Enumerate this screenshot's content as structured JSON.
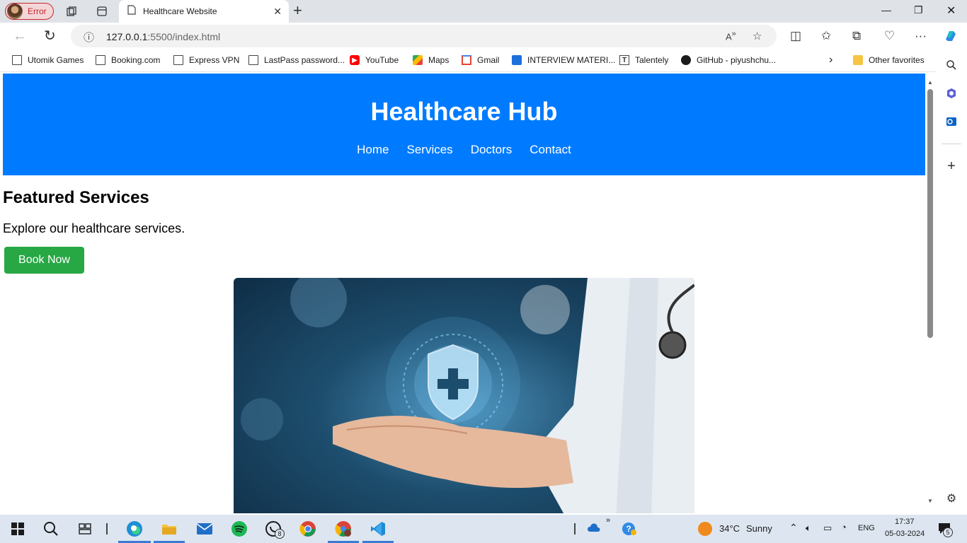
{
  "browser": {
    "profile_label": "Error",
    "tab_title": "Healthcare Website",
    "url_host": "127.0.0.1",
    "url_path": ":5500/index.html",
    "favorites": [
      {
        "label": "Utomik Games",
        "icon": "page-icon"
      },
      {
        "label": "Booking.com",
        "icon": "page-icon"
      },
      {
        "label": "Express VPN",
        "icon": "page-icon"
      },
      {
        "label": "LastPass password...",
        "icon": "page-icon"
      },
      {
        "label": "YouTube",
        "icon": "youtube-icon"
      },
      {
        "label": "Maps",
        "icon": "maps-icon"
      },
      {
        "label": "Gmail",
        "icon": "gmail-icon"
      },
      {
        "label": "INTERVIEW MATERI...",
        "icon": "interview-icon"
      },
      {
        "label": "Talentely",
        "icon": "talentely-icon"
      },
      {
        "label": "GitHub - piyushchu...",
        "icon": "github-icon"
      }
    ],
    "other_favorites": "Other favorites"
  },
  "site": {
    "title": "Healthcare Hub",
    "nav": [
      "Home",
      "Services",
      "Doctors",
      "Contact"
    ],
    "featured_title": "Featured Services",
    "featured_text": "Explore our healthcare services.",
    "book_button": "Book Now",
    "hero_image": "doctor-hand-shield-image"
  },
  "taskbar": {
    "whatsapp_badge": "8",
    "weather_temp": "34°C",
    "weather_text": "Sunny",
    "language": "ENG",
    "time": "17:37",
    "date": "05-03-2024",
    "notification_count": "5"
  },
  "colors": {
    "header_blue": "#007bff",
    "book_green": "#28a745"
  }
}
